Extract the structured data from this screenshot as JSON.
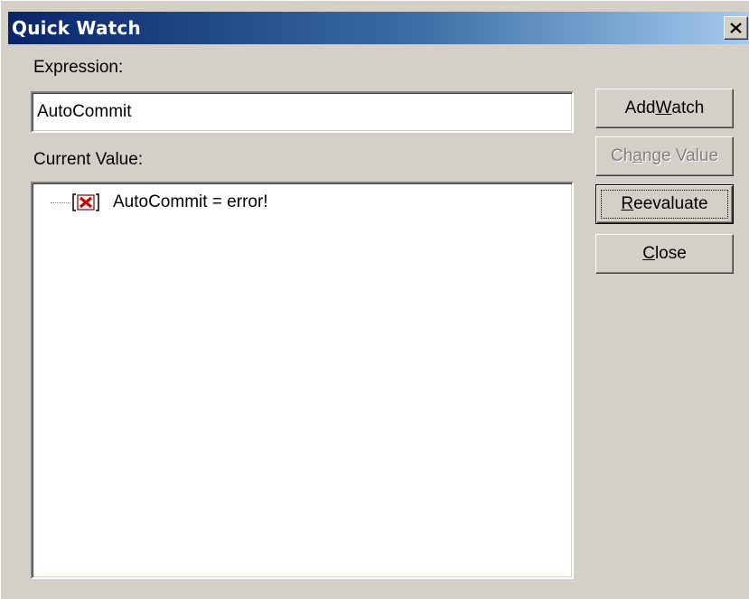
{
  "window": {
    "title": "Quick Watch",
    "close_glyph": "×"
  },
  "expression": {
    "label": "Expression:",
    "value": "AutoCommit"
  },
  "current_value": {
    "label": "Current Value:",
    "items": [
      {
        "icon": "error-icon",
        "text": "AutoCommit = error!"
      }
    ]
  },
  "buttons": {
    "add_watch": {
      "pre": "Add ",
      "accel": "W",
      "post": "atch",
      "enabled": true
    },
    "change_value": {
      "pre": "Ch",
      "accel": "a",
      "post": "nge Value",
      "enabled": false
    },
    "reevaluate": {
      "pre": "",
      "accel": "R",
      "post": "eevaluate",
      "enabled": true,
      "focused": true
    },
    "close": {
      "pre": "",
      "accel": "C",
      "post": "lose",
      "enabled": true
    }
  },
  "colors": {
    "titlebar_start": "#0a246a",
    "titlebar_end": "#a6caf0",
    "dialog_bg": "#d4d0c8",
    "error_icon": "#cc0000"
  }
}
